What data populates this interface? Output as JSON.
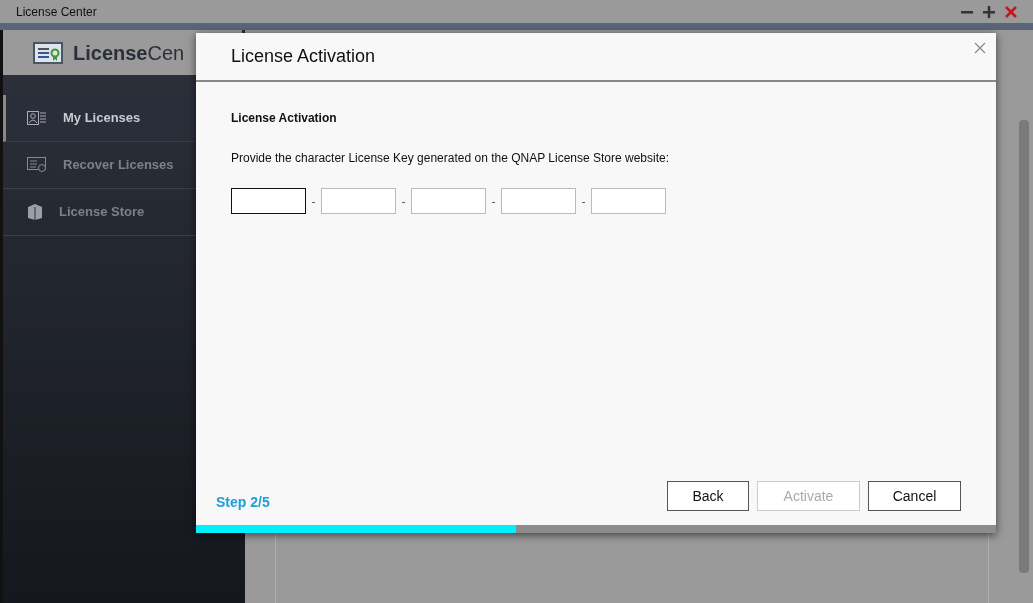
{
  "window": {
    "title": "License Center"
  },
  "app_header": {
    "logo_text": "**License**Cen"
  },
  "sidebar": {
    "items": [
      {
        "label": "My Licenses",
        "selected": true
      },
      {
        "label": "Recover Licenses",
        "selected": false
      },
      {
        "label": "License Store",
        "selected": false
      }
    ]
  },
  "dialog": {
    "title": "License Activation",
    "section_title": "License Activation",
    "instruction": "Provide the character License Key generated on the QNAP License Store website:",
    "key_fields": [
      {
        "focused": true
      },
      {
        "focused": false
      },
      {
        "focused": false
      },
      {
        "focused": false
      },
      {
        "focused": false
      }
    ],
    "separator": "-",
    "step": "Step 2/5",
    "progress": {
      "level": 0.4
    },
    "buttons": [
      {
        "label": "Back",
        "disabled": false
      },
      {
        "label": "Activate",
        "disabled": true
      },
      {
        "label": "Cancel",
        "disabled": false
      }
    ]
  }
}
